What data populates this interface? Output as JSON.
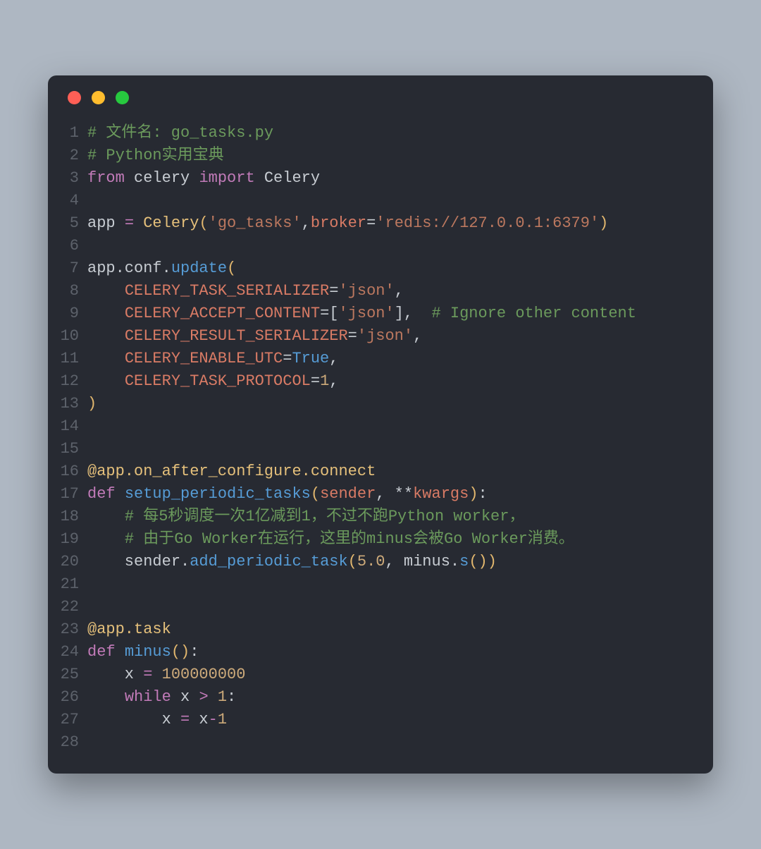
{
  "lines": [
    {
      "n": "1",
      "frags": [
        {
          "c": "cm",
          "t": "# 文件名: go_tasks.py"
        }
      ]
    },
    {
      "n": "2",
      "frags": [
        {
          "c": "cm",
          "t": "# Python实用宝典"
        }
      ]
    },
    {
      "n": "3",
      "frags": [
        {
          "c": "kw",
          "t": "from"
        },
        {
          "c": "mod",
          "t": " celery "
        },
        {
          "c": "kw",
          "t": "import"
        },
        {
          "c": "mod",
          "t": " Celery"
        }
      ]
    },
    {
      "n": "4",
      "frags": []
    },
    {
      "n": "5",
      "frags": [
        {
          "c": "var",
          "t": "app "
        },
        {
          "c": "kw",
          "t": "="
        },
        {
          "c": "var",
          "t": " "
        },
        {
          "c": "cls",
          "t": "Celery"
        },
        {
          "c": "par",
          "t": "("
        },
        {
          "c": "str",
          "t": "'go_tasks'"
        },
        {
          "c": "var",
          "t": ","
        },
        {
          "c": "kwarg",
          "t": "broker"
        },
        {
          "c": "var",
          "t": "="
        },
        {
          "c": "str",
          "t": "'redis://127.0.0.1:6379'"
        },
        {
          "c": "par",
          "t": ")"
        }
      ]
    },
    {
      "n": "6",
      "frags": []
    },
    {
      "n": "7",
      "frags": [
        {
          "c": "var",
          "t": "app.conf."
        },
        {
          "c": "fn",
          "t": "update"
        },
        {
          "c": "par",
          "t": "("
        }
      ]
    },
    {
      "n": "8",
      "frags": [
        {
          "c": "var",
          "t": "    "
        },
        {
          "c": "kwarg",
          "t": "CELERY_TASK_SERIALIZER"
        },
        {
          "c": "var",
          "t": "="
        },
        {
          "c": "str",
          "t": "'json'"
        },
        {
          "c": "var",
          "t": ","
        }
      ]
    },
    {
      "n": "9",
      "frags": [
        {
          "c": "var",
          "t": "    "
        },
        {
          "c": "kwarg",
          "t": "CELERY_ACCEPT_CONTENT"
        },
        {
          "c": "var",
          "t": "=["
        },
        {
          "c": "str",
          "t": "'json'"
        },
        {
          "c": "var",
          "t": "],  "
        },
        {
          "c": "cm",
          "t": "# Ignore other content"
        }
      ]
    },
    {
      "n": "10",
      "frags": [
        {
          "c": "var",
          "t": "    "
        },
        {
          "c": "kwarg",
          "t": "CELERY_RESULT_SERIALIZER"
        },
        {
          "c": "var",
          "t": "="
        },
        {
          "c": "str",
          "t": "'json'"
        },
        {
          "c": "var",
          "t": ","
        }
      ]
    },
    {
      "n": "11",
      "frags": [
        {
          "c": "var",
          "t": "    "
        },
        {
          "c": "kwarg",
          "t": "CELERY_ENABLE_UTC"
        },
        {
          "c": "var",
          "t": "="
        },
        {
          "c": "bool",
          "t": "True"
        },
        {
          "c": "var",
          "t": ","
        }
      ]
    },
    {
      "n": "12",
      "frags": [
        {
          "c": "var",
          "t": "    "
        },
        {
          "c": "kwarg",
          "t": "CELERY_TASK_PROTOCOL"
        },
        {
          "c": "var",
          "t": "="
        },
        {
          "c": "num",
          "t": "1"
        },
        {
          "c": "var",
          "t": ","
        }
      ]
    },
    {
      "n": "13",
      "frags": [
        {
          "c": "par",
          "t": ")"
        }
      ]
    },
    {
      "n": "14",
      "frags": []
    },
    {
      "n": "15",
      "frags": []
    },
    {
      "n": "16",
      "frags": [
        {
          "c": "dec",
          "t": "@app.on_after_configure.connect"
        }
      ]
    },
    {
      "n": "17",
      "frags": [
        {
          "c": "def",
          "t": "def"
        },
        {
          "c": "var",
          "t": " "
        },
        {
          "c": "name",
          "t": "setup_periodic_tasks"
        },
        {
          "c": "par",
          "t": "("
        },
        {
          "c": "kwarg",
          "t": "sender"
        },
        {
          "c": "var",
          "t": ", **"
        },
        {
          "c": "kwarg",
          "t": "kwargs"
        },
        {
          "c": "par",
          "t": ")"
        },
        {
          "c": "var",
          "t": ":"
        }
      ]
    },
    {
      "n": "18",
      "frags": [
        {
          "c": "var",
          "t": "    "
        },
        {
          "c": "cm",
          "t": "# 每5秒调度一次1亿减到1，不过不跑Python worker，"
        }
      ]
    },
    {
      "n": "19",
      "frags": [
        {
          "c": "var",
          "t": "    "
        },
        {
          "c": "cm",
          "t": "# 由于Go Worker在运行，这里的minus会被Go Worker消费。"
        }
      ]
    },
    {
      "n": "20",
      "frags": [
        {
          "c": "var",
          "t": "    sender."
        },
        {
          "c": "fn",
          "t": "add_periodic_task"
        },
        {
          "c": "par",
          "t": "("
        },
        {
          "c": "num",
          "t": "5.0"
        },
        {
          "c": "var",
          "t": ", minus."
        },
        {
          "c": "fn",
          "t": "s"
        },
        {
          "c": "par",
          "t": "())"
        }
      ]
    },
    {
      "n": "21",
      "frags": []
    },
    {
      "n": "22",
      "frags": []
    },
    {
      "n": "23",
      "frags": [
        {
          "c": "dec",
          "t": "@app.task"
        }
      ]
    },
    {
      "n": "24",
      "frags": [
        {
          "c": "def",
          "t": "def"
        },
        {
          "c": "var",
          "t": " "
        },
        {
          "c": "name",
          "t": "minus"
        },
        {
          "c": "par",
          "t": "()"
        },
        {
          "c": "var",
          "t": ":"
        }
      ]
    },
    {
      "n": "25",
      "frags": [
        {
          "c": "var",
          "t": "    x "
        },
        {
          "c": "kw",
          "t": "="
        },
        {
          "c": "var",
          "t": " "
        },
        {
          "c": "num",
          "t": "100000000"
        }
      ]
    },
    {
      "n": "26",
      "frags": [
        {
          "c": "var",
          "t": "    "
        },
        {
          "c": "kw",
          "t": "while"
        },
        {
          "c": "var",
          "t": " x "
        },
        {
          "c": "kw",
          "t": ">"
        },
        {
          "c": "var",
          "t": " "
        },
        {
          "c": "num",
          "t": "1"
        },
        {
          "c": "var",
          "t": ":"
        }
      ]
    },
    {
      "n": "27",
      "frags": [
        {
          "c": "var",
          "t": "        x "
        },
        {
          "c": "kw",
          "t": "="
        },
        {
          "c": "var",
          "t": " x"
        },
        {
          "c": "kw",
          "t": "-"
        },
        {
          "c": "num",
          "t": "1"
        }
      ]
    },
    {
      "n": "28",
      "frags": []
    }
  ]
}
